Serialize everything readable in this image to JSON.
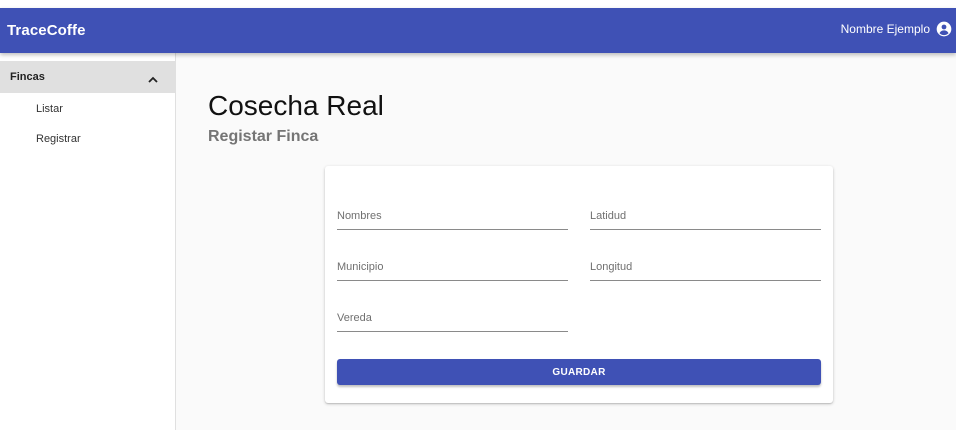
{
  "appbar": {
    "brand": "TraceCoffe",
    "user_name": "Nombre Ejemplo",
    "user_icon": "account-circle-icon",
    "color": "#3f51b5"
  },
  "sidebar": {
    "group_label": "Fincas",
    "group_icon": "chevron-up-icon",
    "items": [
      {
        "label": "Listar"
      },
      {
        "label": "Registrar"
      }
    ]
  },
  "page": {
    "title": "Cosecha Real",
    "subtitle": "Registar Finca"
  },
  "form": {
    "fields": [
      {
        "placeholder": "Nombres",
        "value": ""
      },
      {
        "placeholder": "Latidud",
        "value": ""
      },
      {
        "placeholder": "Municipio",
        "value": ""
      },
      {
        "placeholder": "Longitud",
        "value": ""
      },
      {
        "placeholder": "Vereda",
        "value": ""
      }
    ],
    "submit_label": "GUARDAR"
  }
}
